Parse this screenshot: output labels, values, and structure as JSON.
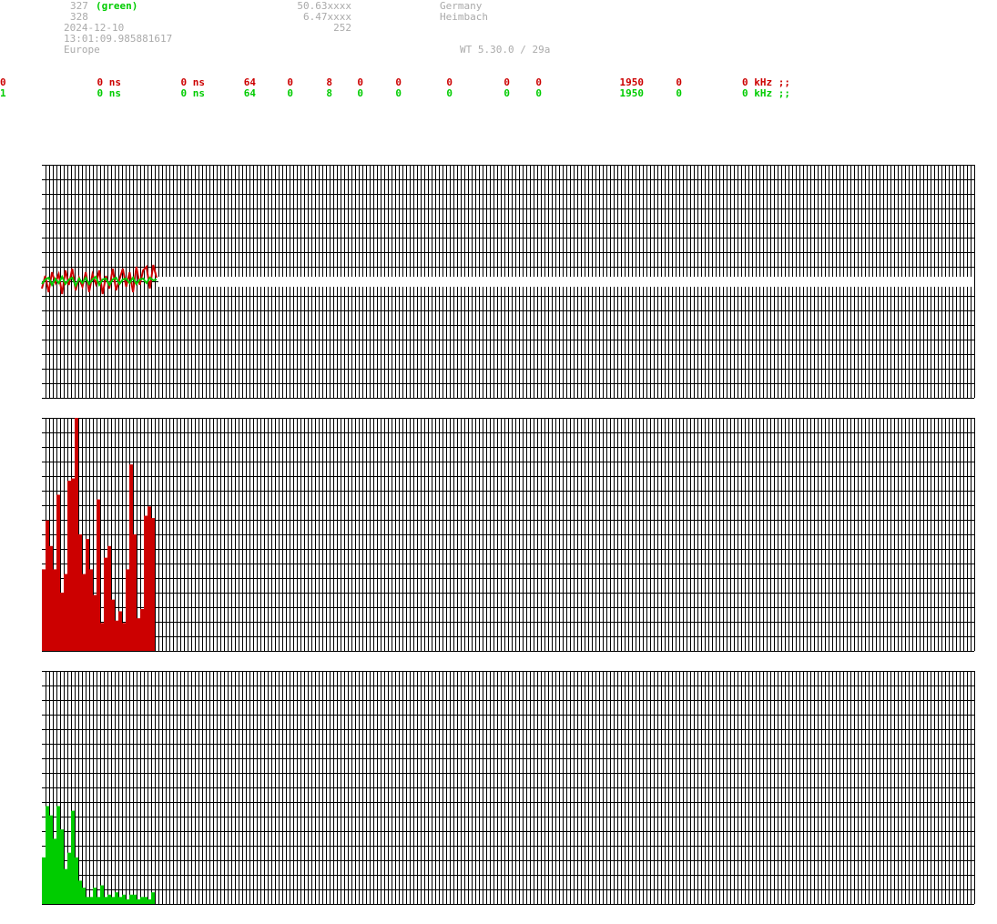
{
  "header": {
    "station_red_id": "327",
    "station_green_label": "(green)",
    "station_alt_id": "328",
    "date": "2024-12-10",
    "time": "13:01:09.985881617",
    "region": "Europe",
    "lat": "50.63xxxx",
    "lon": "6.47xxxx",
    "alt": "252",
    "country": "Germany",
    "city": "Heimbach",
    "version": "WT 5.30.0 / 29a"
  },
  "rows": [
    {
      "color": "red",
      "cells": [
        "0",
        "0 ns",
        "0 ns",
        "64",
        "0",
        "8",
        "0",
        "0",
        "0",
        "0",
        "0",
        "1950",
        "0",
        "0 kHz ;;"
      ]
    },
    {
      "color": "green",
      "cells": [
        "1",
        "0 ns",
        "0 ns",
        "64",
        "0",
        "8",
        "0",
        "0",
        "0",
        "0",
        "0",
        "1950",
        "0",
        "0 kHz ;;"
      ]
    }
  ],
  "colors": {
    "red": "#cc0000",
    "green": "#00cc00",
    "grid": "#000000"
  },
  "chart_data": [
    {
      "type": "line",
      "series": [
        {
          "values": [
            -8,
            6,
            -12,
            10,
            -2,
            8,
            -14,
            12,
            -4,
            14,
            -10,
            4,
            -6,
            10,
            -12,
            8,
            -3,
            12,
            -14,
            6,
            -8,
            14,
            -10,
            2,
            14,
            -6,
            10,
            -12,
            16,
            -4,
            12,
            16,
            -8,
            18,
            4
          ]
        },
        {
          "values": [
            -3,
            2,
            4,
            -4,
            3,
            -2,
            5,
            -3,
            2,
            4,
            -5,
            3,
            -2,
            4,
            -3,
            2,
            5,
            -4,
            2,
            3,
            -4,
            2,
            4,
            -3,
            2,
            3,
            -2,
            4,
            -3,
            2,
            3,
            -2,
            4,
            1,
            2
          ]
        }
      ]
    },
    {
      "type": "bar",
      "values": [
        0.35,
        0.56,
        0.45,
        0.35,
        0.67,
        0.25,
        0.33,
        0.73,
        0.74,
        1.0,
        0.5,
        0.33,
        0.48,
        0.35,
        0.24,
        0.65,
        0.12,
        0.4,
        0.45,
        0.22,
        0.13,
        0.17,
        0.12,
        0.35,
        0.8,
        0.5,
        0.14,
        0.18,
        0.58,
        0.62,
        0.57
      ]
    },
    {
      "type": "bar",
      "values": [
        0.2,
        0.42,
        0.38,
        0.28,
        0.42,
        0.32,
        0.15,
        0.22,
        0.4,
        0.2,
        0.1,
        0.07,
        0.03,
        0.03,
        0.07,
        0.03,
        0.08,
        0.03,
        0.04,
        0.03,
        0.05,
        0.03,
        0.04,
        0.02,
        0.04,
        0.04,
        0.02,
        0.03,
        0.03,
        0.02,
        0.05
      ]
    }
  ]
}
